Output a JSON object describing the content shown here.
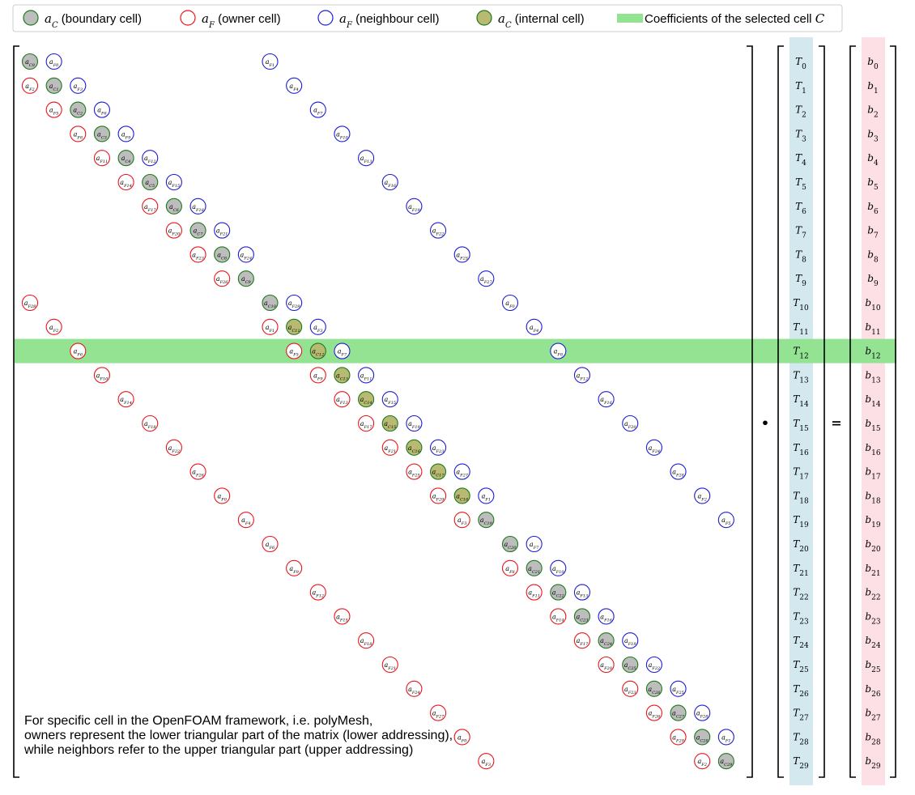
{
  "legend": {
    "boundary_label": "(boundary cell)",
    "owner_label": "(owner cell)",
    "neighbour_label": "(neighbour cell)",
    "internal_label": "(internal cell)",
    "selected_label": "Coefficients of the selected cell"
  },
  "operators": {
    "dot": "•",
    "equals": "="
  },
  "note": {
    "line1": "For specific cell in the OpenFOAM framework, i.e. polyMesh,",
    "line2": "owners represent the lower triangular part of the matrix (lower addressing),",
    "line3": "while neighbors refer to the upper triangular part (upper addressing)"
  },
  "matrix": {
    "size": 30,
    "selected_row": 12,
    "internal_rows": [
      11,
      12,
      13,
      14,
      15,
      16,
      17,
      18
    ],
    "owner_label": "a_F",
    "neighbour_label": "a_F",
    "diag_label": "a_C"
  },
  "colors": {
    "owner": "#e8151b",
    "neighbour": "#1d1dd6",
    "diag_stroke": "#1b7a1b",
    "boundary_fill": "#bdbdbd",
    "internal_fill": "#b8ba72",
    "selected_band": "#93e393",
    "t_column": "#d3e9ef",
    "b_column": "#fde0e5"
  }
}
